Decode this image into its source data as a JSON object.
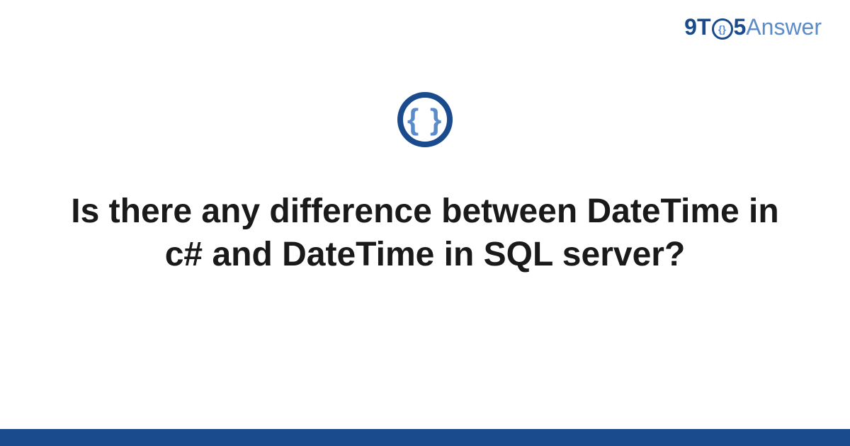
{
  "header": {
    "logo": {
      "part1": "9T",
      "circle_inner": "{}",
      "part2": "5",
      "part3": "Answer"
    }
  },
  "badge": {
    "symbol": "{ }",
    "semantic": "code-braces-icon"
  },
  "content": {
    "question_title": "Is there any difference between DateTime in c# and DateTime in SQL server?"
  },
  "colors": {
    "primary_dark": "#1a4b8c",
    "primary_light": "#5b8bc9",
    "text": "#1a1a1a",
    "background": "#ffffff"
  }
}
